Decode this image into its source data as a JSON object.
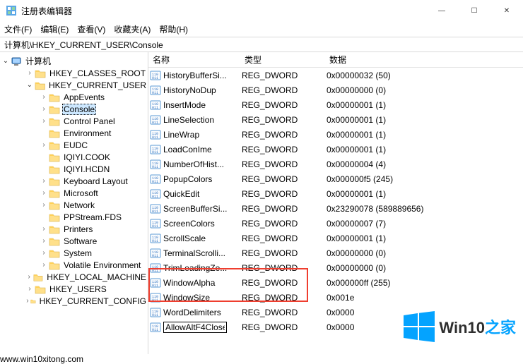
{
  "window": {
    "title": "注册表编辑器",
    "minimize": "—",
    "maximize": "☐",
    "close": "✕"
  },
  "menu": {
    "file": "文件(F)",
    "edit": "编辑(E)",
    "view": "查看(V)",
    "favorites": "收藏夹(A)",
    "help": "帮助(H)"
  },
  "address": "计算机\\HKEY_CURRENT_USER\\Console",
  "tree": {
    "root": "计算机",
    "items": [
      {
        "label": "HKEY_CLASSES_ROOT",
        "indent": 36,
        "caret": "closed"
      },
      {
        "label": "HKEY_CURRENT_USER",
        "indent": 36,
        "caret": "open"
      },
      {
        "label": "AppEvents",
        "indent": 56,
        "caret": "closed"
      },
      {
        "label": "Console",
        "indent": 56,
        "caret": "closed",
        "selected": true
      },
      {
        "label": "Control Panel",
        "indent": 56,
        "caret": "closed"
      },
      {
        "label": "Environment",
        "indent": 56,
        "caret": "none"
      },
      {
        "label": "EUDC",
        "indent": 56,
        "caret": "closed"
      },
      {
        "label": "IQIYI.COOK",
        "indent": 56,
        "caret": "none"
      },
      {
        "label": "IQIYI.HCDN",
        "indent": 56,
        "caret": "none"
      },
      {
        "label": "Keyboard Layout",
        "indent": 56,
        "caret": "closed"
      },
      {
        "label": "Microsoft",
        "indent": 56,
        "caret": "closed"
      },
      {
        "label": "Network",
        "indent": 56,
        "caret": "closed"
      },
      {
        "label": "PPStream.FDS",
        "indent": 56,
        "caret": "none"
      },
      {
        "label": "Printers",
        "indent": 56,
        "caret": "closed"
      },
      {
        "label": "Software",
        "indent": 56,
        "caret": "closed"
      },
      {
        "label": "System",
        "indent": 56,
        "caret": "closed"
      },
      {
        "label": "Volatile Environment",
        "indent": 56,
        "caret": "closed"
      },
      {
        "label": "HKEY_LOCAL_MACHINE",
        "indent": 36,
        "caret": "closed"
      },
      {
        "label": "HKEY_USERS",
        "indent": 36,
        "caret": "closed"
      },
      {
        "label": "HKEY_CURRENT_CONFIG",
        "indent": 36,
        "caret": "closed"
      }
    ]
  },
  "columns": {
    "name": "名称",
    "type": "类型",
    "data": "数据"
  },
  "values": [
    {
      "name": "HistoryBufferSi...",
      "type": "REG_DWORD",
      "data": "0x00000032 (50)"
    },
    {
      "name": "HistoryNoDup",
      "type": "REG_DWORD",
      "data": "0x00000000 (0)"
    },
    {
      "name": "InsertMode",
      "type": "REG_DWORD",
      "data": "0x00000001 (1)"
    },
    {
      "name": "LineSelection",
      "type": "REG_DWORD",
      "data": "0x00000001 (1)"
    },
    {
      "name": "LineWrap",
      "type": "REG_DWORD",
      "data": "0x00000001 (1)"
    },
    {
      "name": "LoadConIme",
      "type": "REG_DWORD",
      "data": "0x00000001 (1)"
    },
    {
      "name": "NumberOfHist...",
      "type": "REG_DWORD",
      "data": "0x00000004 (4)"
    },
    {
      "name": "PopupColors",
      "type": "REG_DWORD",
      "data": "0x000000f5 (245)"
    },
    {
      "name": "QuickEdit",
      "type": "REG_DWORD",
      "data": "0x00000001 (1)"
    },
    {
      "name": "ScreenBufferSi...",
      "type": "REG_DWORD",
      "data": "0x23290078 (589889656)"
    },
    {
      "name": "ScreenColors",
      "type": "REG_DWORD",
      "data": "0x00000007 (7)"
    },
    {
      "name": "ScrollScale",
      "type": "REG_DWORD",
      "data": "0x00000001 (1)"
    },
    {
      "name": "TerminalScrolli...",
      "type": "REG_DWORD",
      "data": "0x00000000 (0)"
    },
    {
      "name": "TrimLeadingZe...",
      "type": "REG_DWORD",
      "data": "0x00000000 (0)"
    },
    {
      "name": "WindowAlpha",
      "type": "REG_DWORD",
      "data": "0x000000ff (255)"
    },
    {
      "name": "WindowSize",
      "type": "REG_DWORD",
      "data": "0x001e"
    },
    {
      "name": "WordDelimiters",
      "type": "REG_DWORD",
      "data": "0x0000"
    },
    {
      "name": "",
      "type": "REG_DWORD",
      "data": "0x0000",
      "editing": true,
      "editValue": "AllowAltF4Close"
    }
  ],
  "watermark": {
    "text1": "Win10",
    "text2": "之家",
    "url": "www.win10xitong.com"
  },
  "colors": {
    "accent": "#00a2ff",
    "folder": "#ffd96b",
    "redbox": "#ef3e2f",
    "selection": "#cde8ff"
  }
}
